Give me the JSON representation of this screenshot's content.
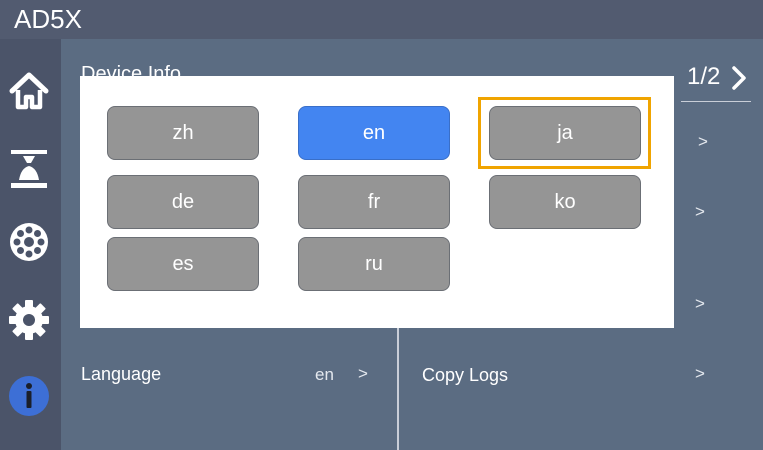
{
  "app": {
    "title": "AD5X"
  },
  "sidebar": {
    "items": [
      {
        "icon": "home-icon"
      },
      {
        "icon": "print-bed-icon"
      },
      {
        "icon": "filament-spool-icon"
      },
      {
        "icon": "gear-icon"
      },
      {
        "icon": "info-icon"
      }
    ]
  },
  "main": {
    "section_title": "Device Info",
    "pager": "1/2",
    "rows_left": [
      {
        "label": "Language",
        "value": "en"
      }
    ],
    "rows_right": [
      {
        "label": "Copy Logs"
      }
    ]
  },
  "language_dialog": {
    "options": [
      "zh",
      "en",
      "ja",
      "de",
      "fr",
      "ko",
      "es",
      "ru"
    ],
    "selected": "en",
    "focused": "ja"
  },
  "colors": {
    "accent": "#4385f1",
    "focus": "#f0a400",
    "button": "#959595"
  }
}
